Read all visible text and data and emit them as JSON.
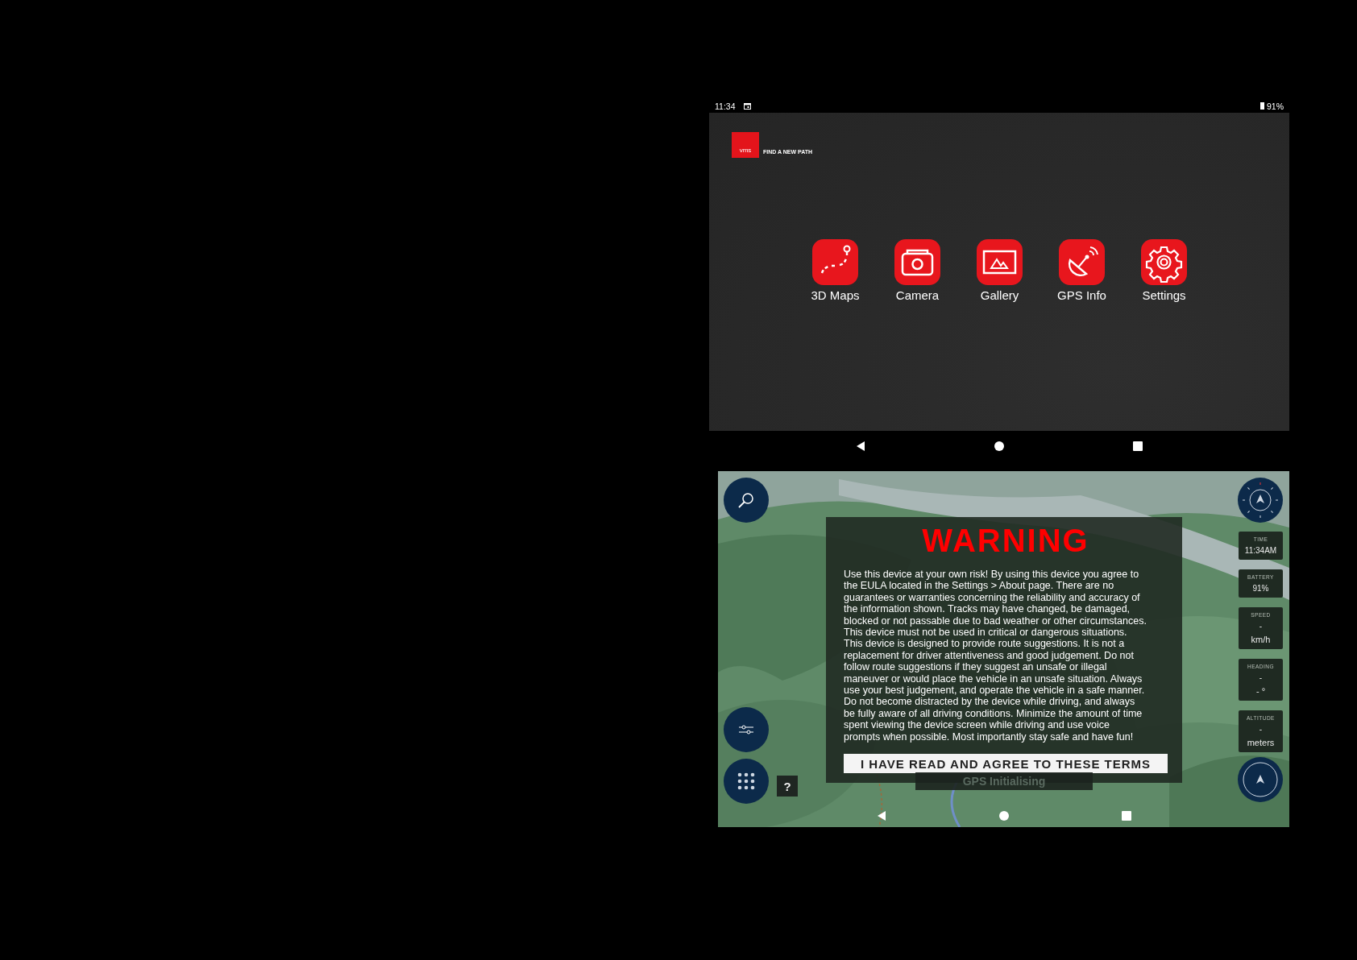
{
  "home_screen": {
    "status_bar": {
      "time": "11:34",
      "battery": "91%"
    },
    "logo": {
      "mark": "vms",
      "tagline": "FIND A NEW PATH"
    },
    "apps": [
      {
        "label": "3D Maps",
        "kind": "route"
      },
      {
        "label": "Camera",
        "kind": "camera"
      },
      {
        "label": "Gallery",
        "kind": "gallery"
      },
      {
        "label": "GPS Info",
        "kind": "satellite"
      },
      {
        "label": "Settings",
        "kind": "gear"
      }
    ]
  },
  "map_screen": {
    "warning": {
      "title": "WARNING",
      "body": "Use this device at your own risk! By using this device you agree to the EULA located in the Settings > About page. There are no guarantees or warranties concerning the reliability and accuracy of the information shown. Tracks may have changed, be damaged, blocked or not passable due to bad weather or other circumstances. This device must not be used in critical or dangerous situations. This device is designed to provide route suggestions. It is not a replacement for driver attentiveness and good judgement. Do not follow route suggestions if they suggest an unsafe or illegal maneuver or would place the vehicle in an unsafe situation. Always use your best judgement, and operate the vehicle in a safe manner. Do not become distracted by the device while driving, and always be fully aware of all driving conditions. Minimize the amount of time spent viewing the device screen while driving and use voice prompts when possible. Most importantly stay safe and have fun!",
      "button": "I HAVE READ AND AGREE TO THESE TERMS"
    },
    "gauges": [
      {
        "label": "TIME",
        "value": "11:34AM"
      },
      {
        "label": "BATTERY",
        "value": "91%"
      },
      {
        "label": "SPEED",
        "value": "-",
        "unit": "km/h"
      },
      {
        "label": "HEADING",
        "value": "-",
        "unit": "- °"
      },
      {
        "label": "ALTITUDE",
        "value": "-",
        "unit": "meters"
      }
    ],
    "help_button": "?",
    "gps_status": "GPS Initialising"
  }
}
